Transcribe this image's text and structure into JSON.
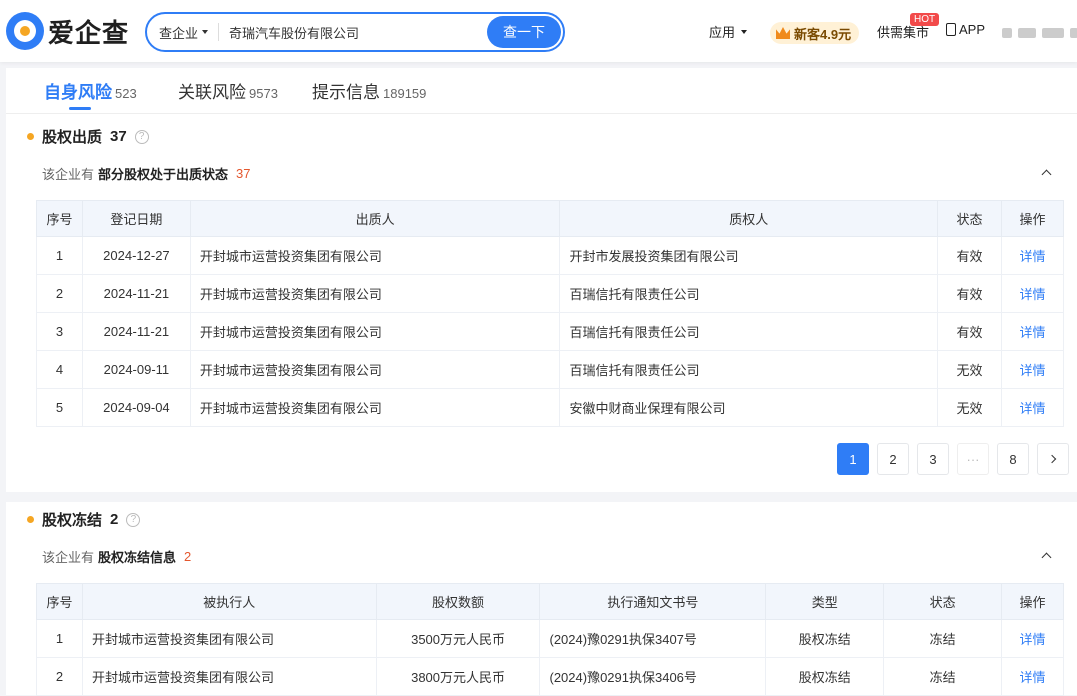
{
  "header": {
    "logo_text": "爱企查",
    "search_type": "查企业",
    "search_value": "奇瑞汽车股份有限公司",
    "search_button": "查一下",
    "nav_apps": "应用",
    "promo_label": "新客4.9元",
    "supply_market": "供需集市",
    "hot_badge": "HOT",
    "app_label": "APP"
  },
  "tabs": [
    {
      "label": "自身风险",
      "count": "523"
    },
    {
      "label": "关联风险",
      "count": "9573"
    },
    {
      "label": "提示信息",
      "count": "189159"
    }
  ],
  "pledge": {
    "title": "股权出质",
    "count": "37",
    "summary_prefix": "该企业有",
    "summary_bold": "部分股权处于出质状态",
    "summary_count": "37",
    "columns": [
      "序号",
      "登记日期",
      "出质人",
      "质权人",
      "状态",
      "操作"
    ],
    "rows": [
      {
        "no": "1",
        "date": "2024-12-27",
        "pledgor": "开封城市运营投资集团有限公司",
        "pledgee": "开封市发展投资集团有限公司",
        "status": "有效",
        "action": "详情"
      },
      {
        "no": "2",
        "date": "2024-11-21",
        "pledgor": "开封城市运营投资集团有限公司",
        "pledgee": "百瑞信托有限责任公司",
        "status": "有效",
        "action": "详情"
      },
      {
        "no": "3",
        "date": "2024-11-21",
        "pledgor": "开封城市运营投资集团有限公司",
        "pledgee": "百瑞信托有限责任公司",
        "status": "有效",
        "action": "详情"
      },
      {
        "no": "4",
        "date": "2024-09-11",
        "pledgor": "开封城市运营投资集团有限公司",
        "pledgee": "百瑞信托有限责任公司",
        "status": "无效",
        "action": "详情"
      },
      {
        "no": "5",
        "date": "2024-09-04",
        "pledgor": "开封城市运营投资集团有限公司",
        "pledgee": "安徽中财商业保理有限公司",
        "status": "无效",
        "action": "详情"
      }
    ],
    "pager": [
      "1",
      "2",
      "3",
      "···",
      "8"
    ]
  },
  "freeze": {
    "title": "股权冻结",
    "count": "2",
    "summary_prefix": "该企业有",
    "summary_bold": "股权冻结信息",
    "summary_count": "2",
    "columns": [
      "序号",
      "被执行人",
      "股权数额",
      "执行通知文书号",
      "类型",
      "状态",
      "操作"
    ],
    "rows": [
      {
        "no": "1",
        "party": "开封城市运营投资集团有限公司",
        "amount": "3500万元人民币",
        "doc": "(2024)豫0291执保3407号",
        "type": "股权冻结",
        "status": "冻结",
        "action": "详情"
      },
      {
        "no": "2",
        "party": "开封城市运营投资集团有限公司",
        "amount": "3800万元人民币",
        "doc": "(2024)豫0291执保3406号",
        "type": "股权冻结",
        "status": "冻结",
        "action": "详情"
      }
    ]
  }
}
